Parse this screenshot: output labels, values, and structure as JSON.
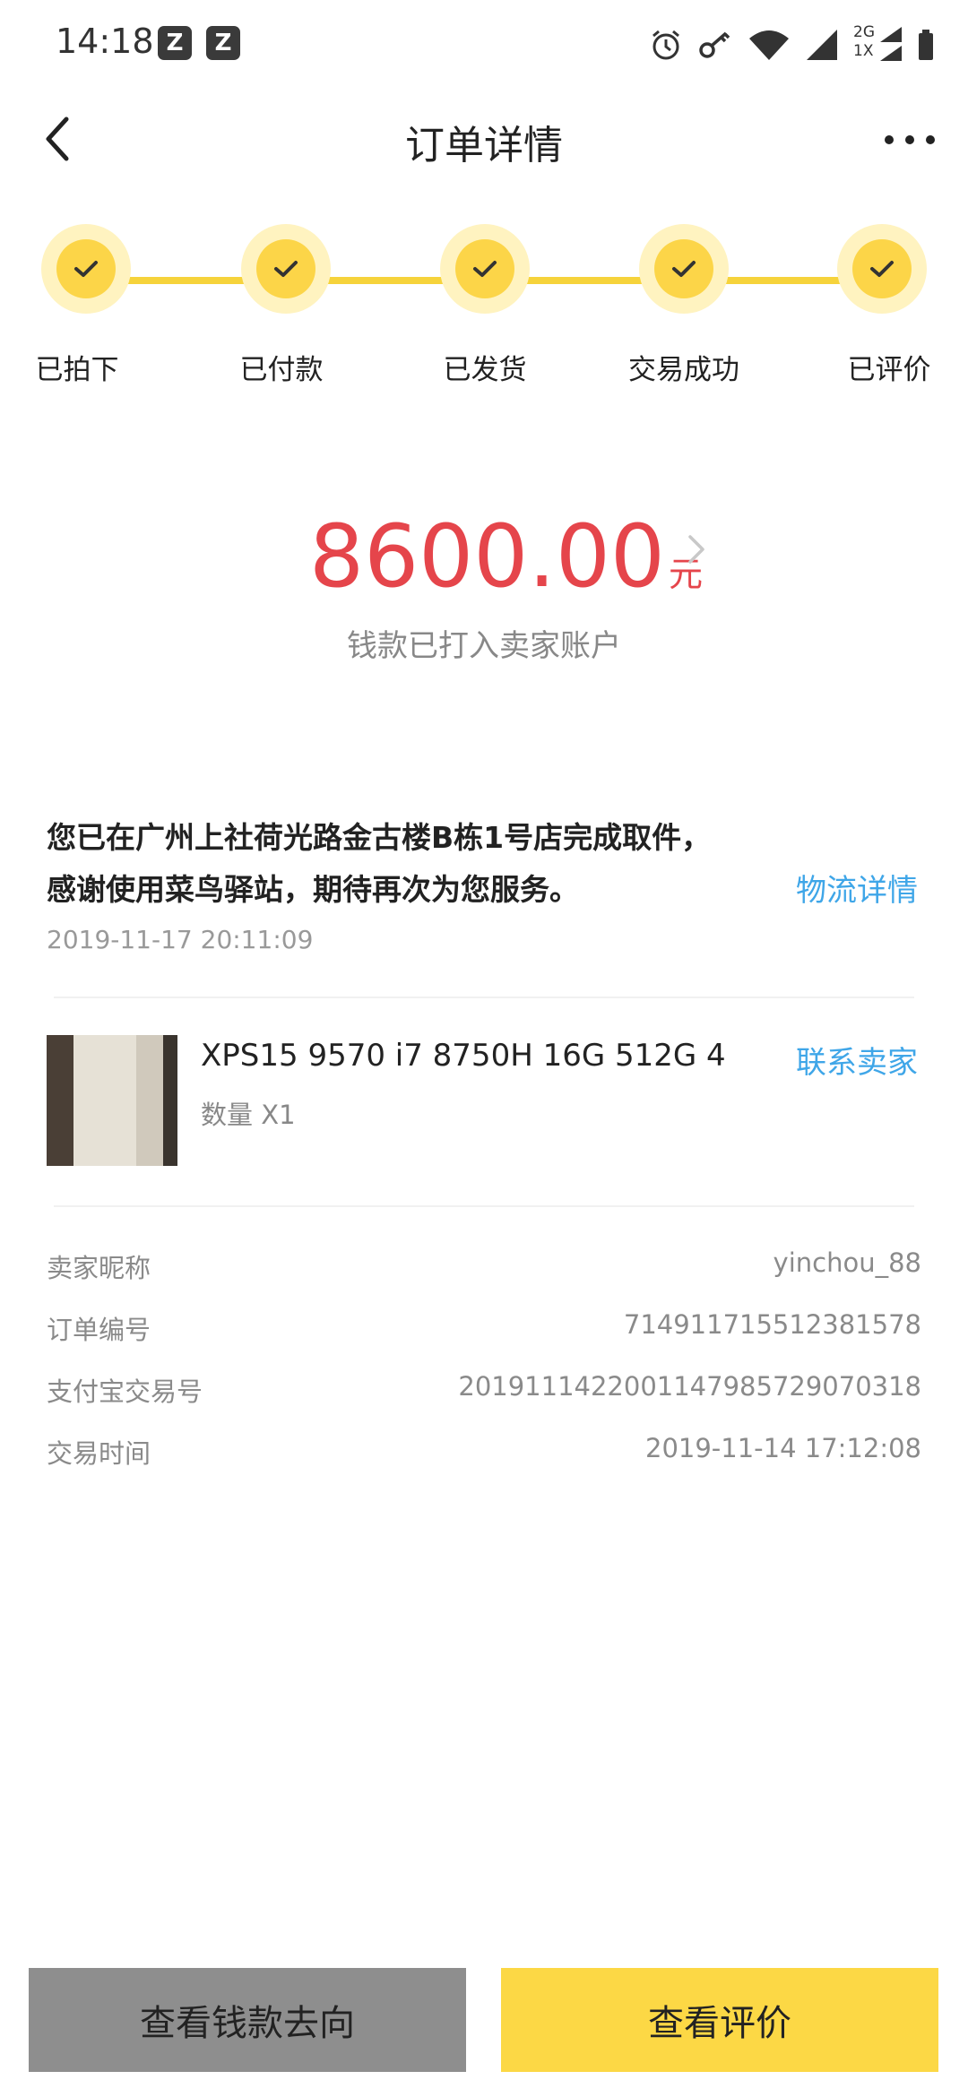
{
  "status_bar": {
    "time": "14:18",
    "notification_icons": [
      "z-app-icon",
      "z-app-icon"
    ],
    "right_icons": [
      "alarm-icon",
      "key-icon",
      "wifi-icon",
      "signal-icon",
      "signal-2g-icon",
      "battery-icon"
    ],
    "network_top": "2G",
    "network_bottom": "1X"
  },
  "nav": {
    "title": "订单详情"
  },
  "progress": {
    "accent": "#fcd548",
    "steps": [
      {
        "label": "已拍下"
      },
      {
        "label": "已付款"
      },
      {
        "label": "已发货"
      },
      {
        "label": "交易成功"
      },
      {
        "label": "已评价"
      }
    ]
  },
  "amount": {
    "value": "8600.00",
    "unit": "元",
    "note": "钱款已打入卖家账户",
    "color": "#e5454b"
  },
  "pickup": {
    "line1": "您已在广州上社荷光路金古楼B栋1号店完成取件，",
    "line2": "感谢使用菜鸟驿站，期待再次为您服务。",
    "time": "2019-11-17 20:11:09",
    "link": "物流详情"
  },
  "product": {
    "name": "XPS15 9570 i7 8750H 16G 512G 4",
    "quantity": "数量 X1",
    "contact": "联系卖家"
  },
  "order_info": [
    {
      "label": "卖家昵称",
      "value": "yinchou_88"
    },
    {
      "label": "订单编号",
      "value": "714911715512381578"
    },
    {
      "label": "支付宝交易号",
      "value": "2019111422001147985729070318"
    },
    {
      "label": "交易时间",
      "value": "2019-11-14 17:12:08"
    }
  ],
  "buttons": {
    "left": "查看钱款去向",
    "right": "查看评价"
  },
  "link_color": "#3fa6e8"
}
